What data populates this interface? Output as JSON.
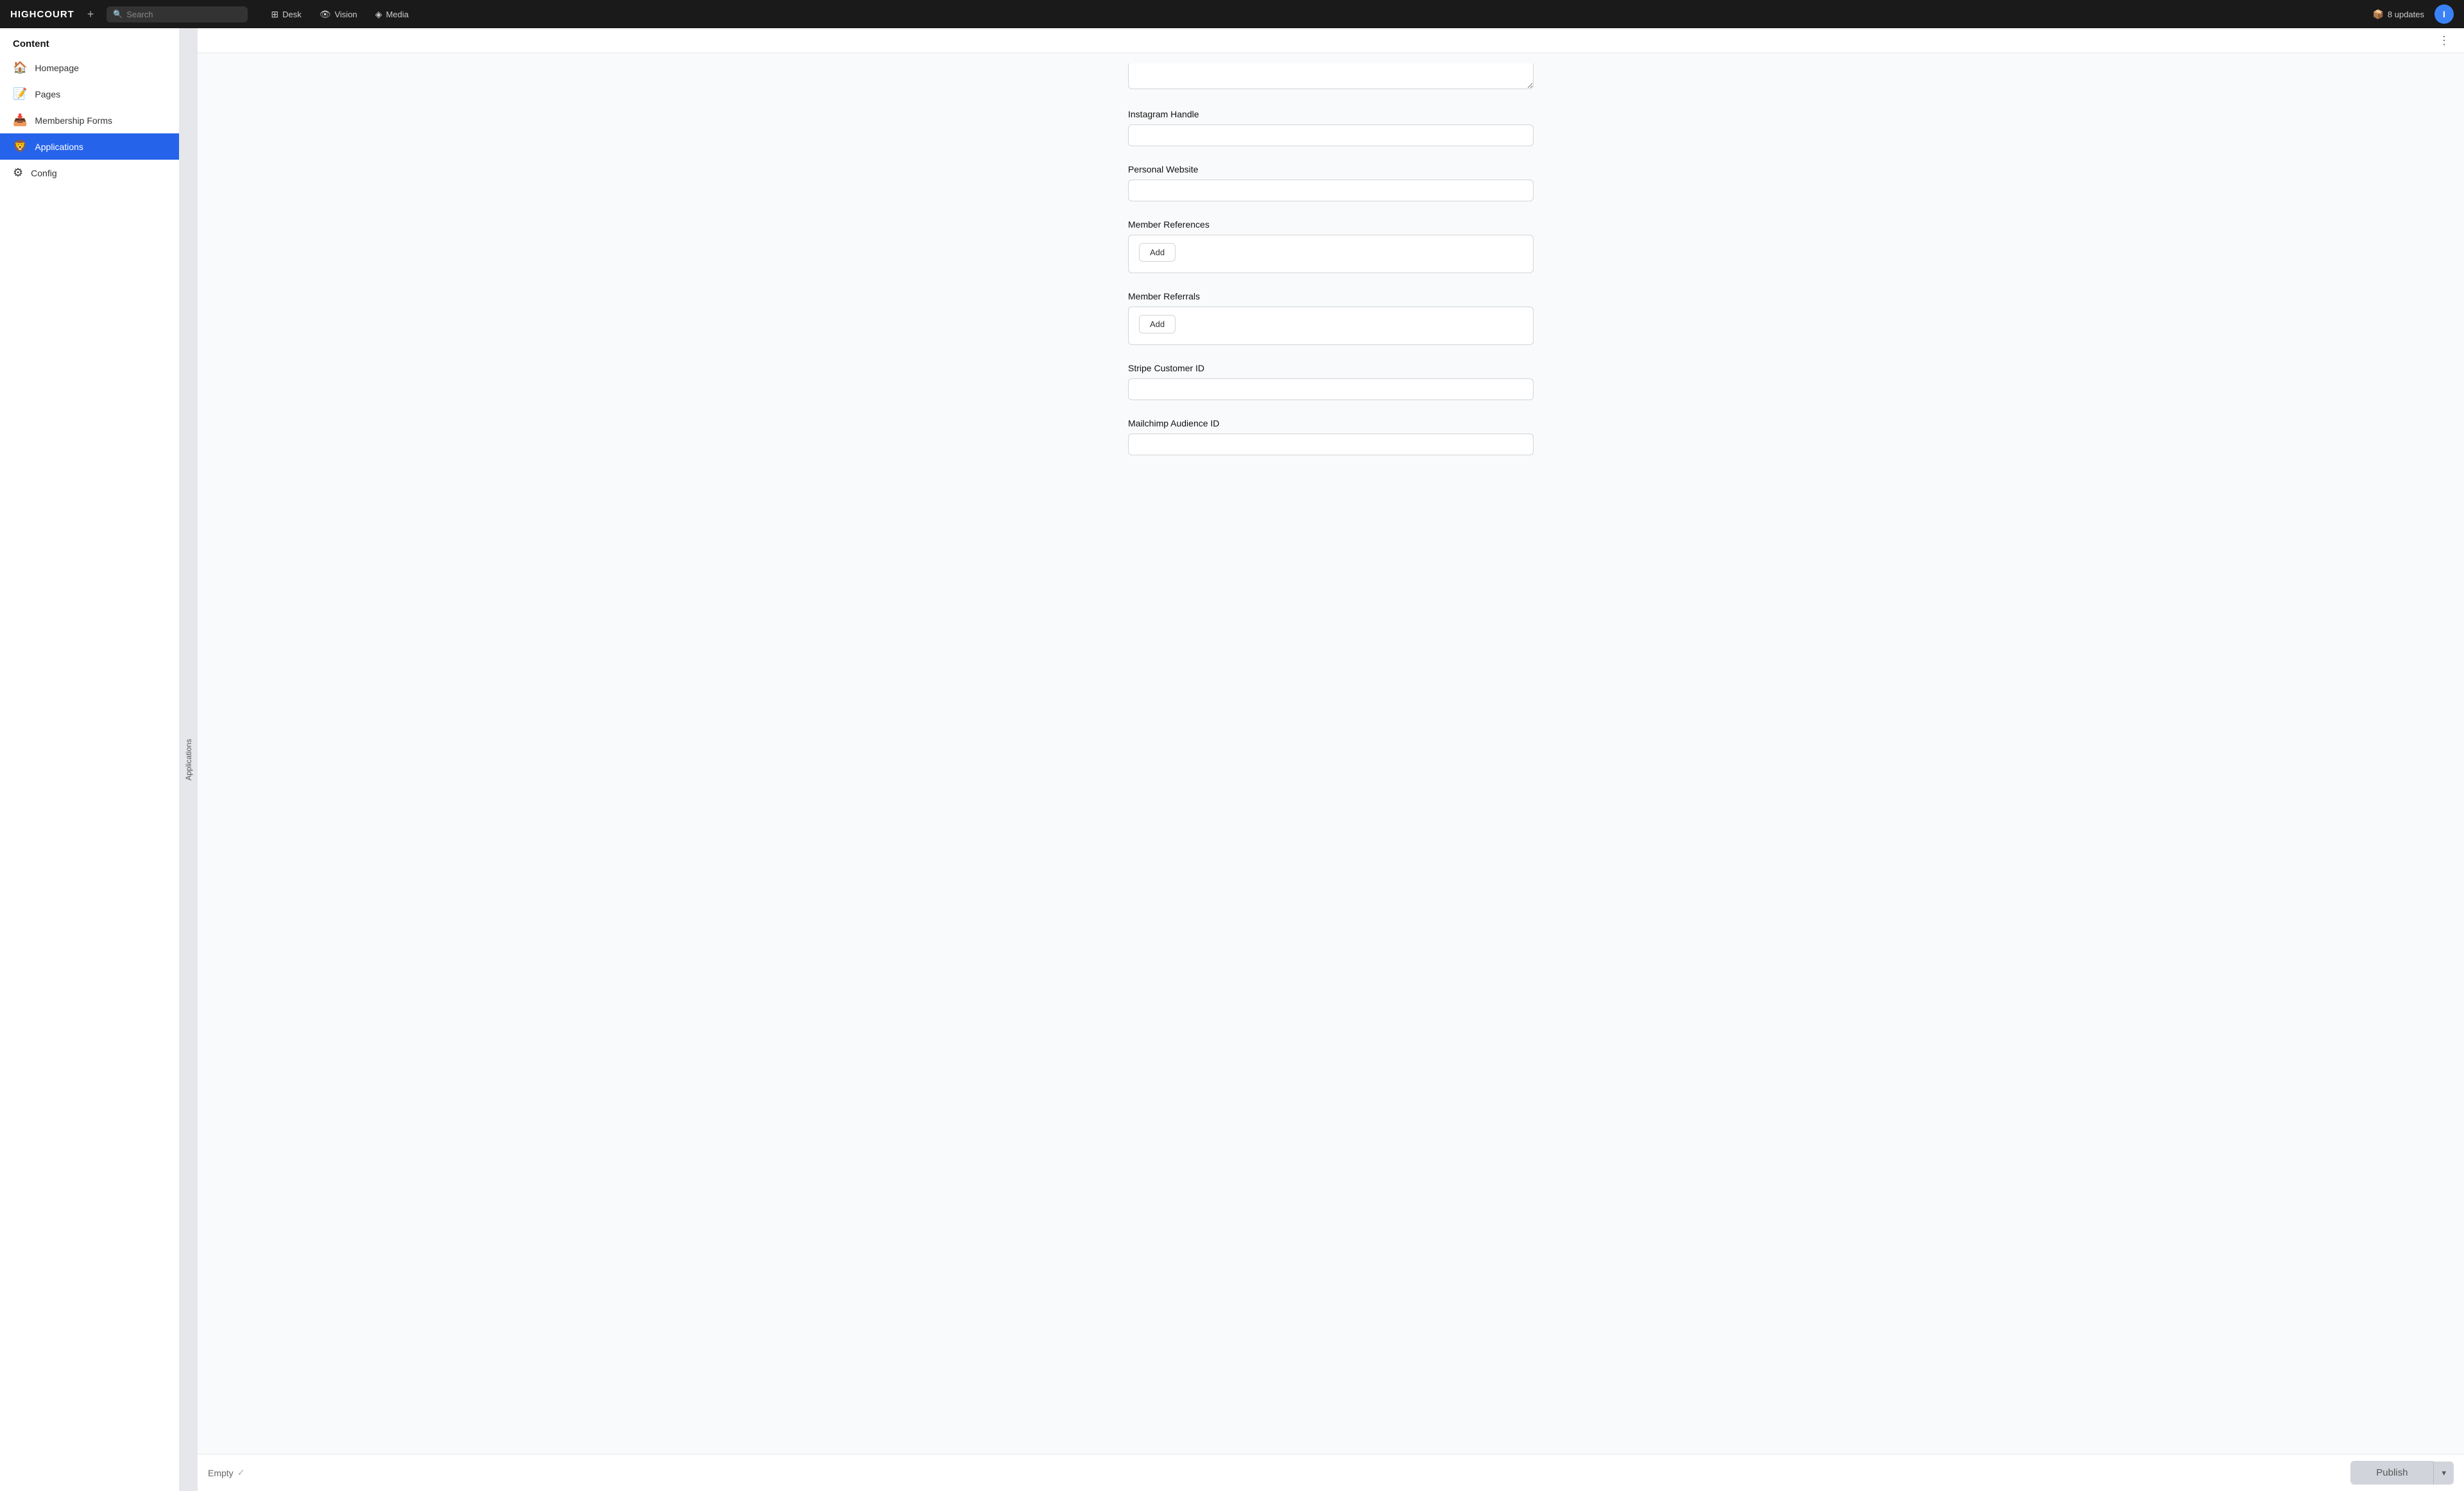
{
  "app": {
    "logo": "HIGHCOURT",
    "add_icon": "+",
    "search_placeholder": "Search"
  },
  "topnav": {
    "tabs": [
      {
        "id": "desk",
        "label": "Desk",
        "icon": "⊞"
      },
      {
        "id": "vision",
        "label": "Vision",
        "icon": "👁"
      },
      {
        "id": "media",
        "label": "Media",
        "icon": "◈"
      }
    ],
    "updates_label": "8 updates",
    "updates_icon": "📦",
    "avatar_letter": "I"
  },
  "sidebar": {
    "header": "Content",
    "items": [
      {
        "id": "homepage",
        "label": "Homepage",
        "icon": "🏠"
      },
      {
        "id": "pages",
        "label": "Pages",
        "icon": "📝"
      },
      {
        "id": "membership-forms",
        "label": "Membership Forms",
        "icon": "📥"
      },
      {
        "id": "applications",
        "label": "Applications",
        "icon": "🦁",
        "active": true
      },
      {
        "id": "config",
        "label": "Config",
        "icon": "⚙"
      }
    ]
  },
  "vertical_tab": {
    "label": "Applications"
  },
  "form": {
    "fields": [
      {
        "id": "instagram-handle",
        "label": "Instagram Handle",
        "type": "input",
        "value": "",
        "placeholder": ""
      },
      {
        "id": "personal-website",
        "label": "Personal Website",
        "type": "input",
        "value": "",
        "placeholder": ""
      },
      {
        "id": "member-references",
        "label": "Member References",
        "type": "add",
        "add_label": "Add"
      },
      {
        "id": "member-referrals",
        "label": "Member Referrals",
        "type": "add",
        "add_label": "Add"
      },
      {
        "id": "stripe-customer-id",
        "label": "Stripe Customer ID",
        "type": "input",
        "value": "",
        "placeholder": ""
      },
      {
        "id": "mailchimp-audience-id",
        "label": "Mailchimp Audience ID",
        "type": "input",
        "value": "",
        "placeholder": ""
      }
    ]
  },
  "bottom_bar": {
    "status": "Empty",
    "status_check": "✓",
    "publish_label": "Publish",
    "dropdown_icon": "⌄"
  },
  "three_dot_menu": "⋮"
}
